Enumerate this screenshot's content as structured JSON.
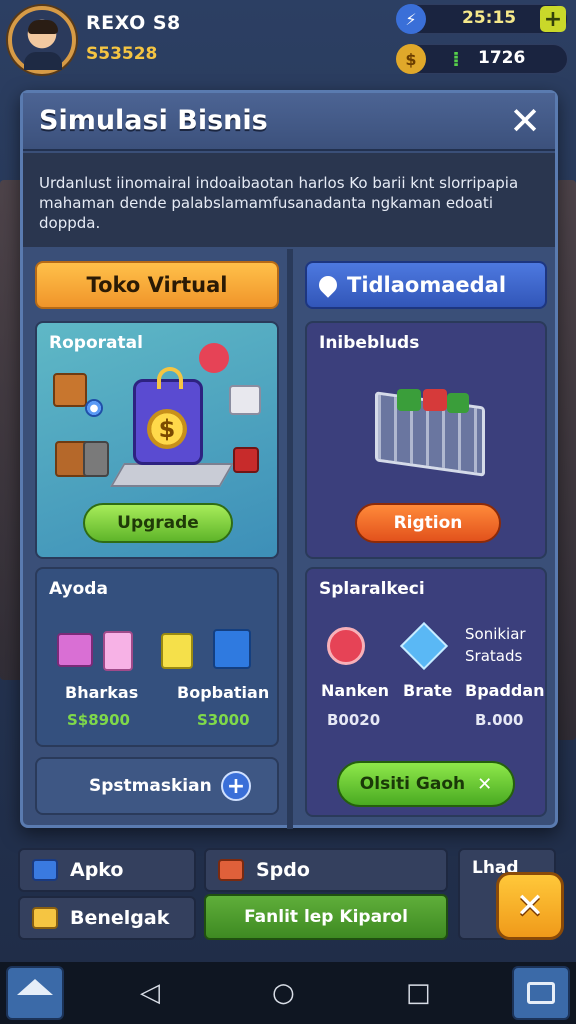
{
  "hud": {
    "player_name": "REXO S8",
    "player_money": "S53528",
    "energy_value": "25:15",
    "gem_value": "1726",
    "plus_label": "+"
  },
  "dialog": {
    "title": "Simulasi Bisnis",
    "close_label": "✕",
    "description": "Urdanlust iinomairal indoaibaotan harlos Ko barii knt slorripapia mahaman dende palabslamamfusanadanta ngkaman edoati doppda."
  },
  "left": {
    "tab_label": "Toko Virtual",
    "panel1_title": "Roporatal",
    "panel1_button": "Upgrade",
    "panel2_title": "Ayoda",
    "items": [
      {
        "label": "Bharkas",
        "price": "S$8900"
      },
      {
        "label": "Bopbatian",
        "price": "S3000"
      }
    ],
    "search_label": "Spstmaskian",
    "search_plus": "+"
  },
  "right": {
    "tab_label": "Tidlaomaedal",
    "panel1_title": "Inibebluds",
    "panel1_button": "Rigtion",
    "panel2_title": "Splaralkeci",
    "stats_header": [
      "Sonikiar",
      "Sratads"
    ],
    "stats": [
      {
        "label": "Nanken",
        "value": "B0020"
      },
      {
        "label": "Brate",
        "value": ""
      },
      {
        "label": "Bpaddan",
        "value": "B.000"
      }
    ],
    "confirm_button": "Olsiti Gaoh",
    "confirm_icon": "✕"
  },
  "tray": {
    "btn1": "Apko",
    "btn2": "Benelgak",
    "btn3": "Spdo",
    "btn4": "Fanlit lep Kiparol",
    "btn5": "Lhad",
    "fab_label": "✕"
  },
  "nav": {
    "back": "◁",
    "home": "○",
    "recent": "□"
  },
  "colors": {
    "accent_orange": "#f5a536",
    "accent_blue": "#3a6fd8",
    "green_button": "#7fd13a",
    "orange_button": "#f06a2a",
    "gold": "#f5c542"
  }
}
